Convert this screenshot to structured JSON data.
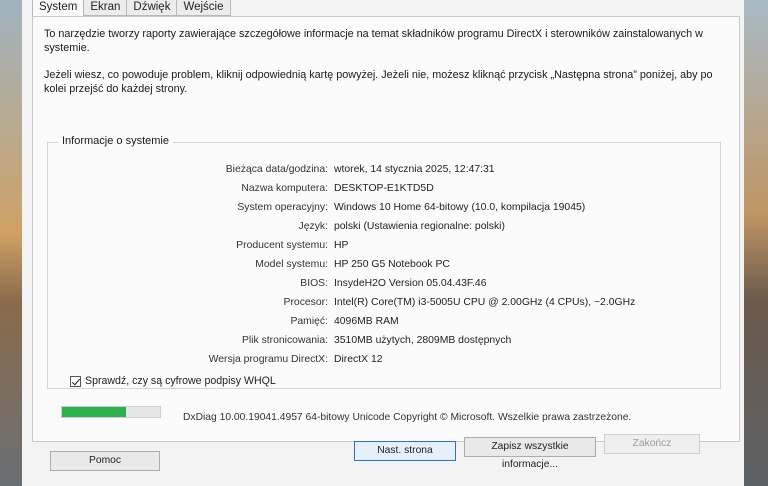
{
  "tabs": [
    "System",
    "Ekran",
    "Dźwięk",
    "Wejście"
  ],
  "intro": {
    "line1": "To narzędzie tworzy raporty zawierające szczegółowe informacje na temat składników programu DirectX i sterowników zainstalowanych w systemie.",
    "line2": "Jeżeli wiesz, co powoduje problem, kliknij odpowiednią kartę powyżej. Jeżeli nie, możesz kliknąć przycisk „Następna strona” poniżej, aby po kolei przejść do każdej strony."
  },
  "system_info": {
    "title": "Informacje o systemie",
    "rows": [
      {
        "label": "Bieżąca data/godzina:",
        "value": "wtorek, 14 stycznia 2025, 12:47:31"
      },
      {
        "label": "Nazwa komputera:",
        "value": "DESKTOP-E1KTD5D"
      },
      {
        "label": "System operacyjny:",
        "value": "Windows 10 Home 64-bitowy (10.0, kompilacja 19045)"
      },
      {
        "label": "Język:",
        "value": "polski (Ustawienia regionalne: polski)"
      },
      {
        "label": "Producent systemu:",
        "value": "HP"
      },
      {
        "label": "Model systemu:",
        "value": "HP 250 G5 Notebook PC"
      },
      {
        "label": "BIOS:",
        "value": "InsydeH2O Version 05.04.43F.46"
      },
      {
        "label": "Procesor:",
        "value": "Intel(R) Core(TM) i3-5005U CPU @ 2.00GHz (4 CPUs), ~2.0GHz"
      },
      {
        "label": "Pamięć:",
        "value": "4096MB RAM"
      },
      {
        "label": "Plik stronicowania:",
        "value": "3510MB użytych, 2809MB dostępnych"
      },
      {
        "label": "Wersja programu DirectX:",
        "value": "DirectX 12"
      }
    ]
  },
  "whql_label": "Sprawdź, czy są cyfrowe podpisy WHQL",
  "whql_checked": true,
  "progress": 0.65,
  "copyright": "DxDiag 10.00.19041.4957 64-bitowy Unicode  Copyright © Microsoft. Wszelkie prawa zastrzeżone.",
  "buttons": {
    "help": "Pomoc",
    "next": "Nast. strona",
    "save": "Zapisz wszystkie informacje...",
    "exit": "Zakończ"
  }
}
